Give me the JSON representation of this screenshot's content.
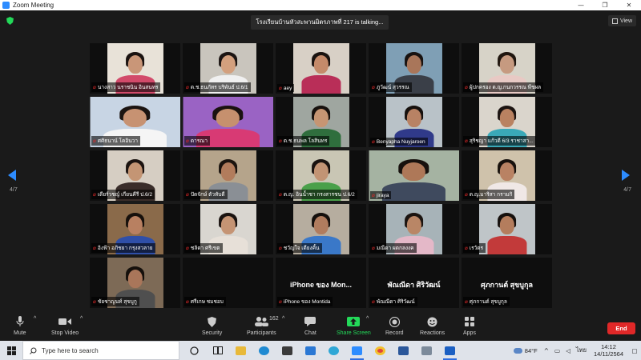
{
  "window": {
    "title": "Zoom Meeting",
    "minimize": "—",
    "restore": "❐",
    "close": "✕"
  },
  "stage": {
    "talking": "โรงเรียนบ้านหัวสะพานมิตรภาพที่ 217 is talking...",
    "view_label": "View",
    "page_left": "4/7",
    "page_right": "4/7"
  },
  "tiles": [
    {
      "name": "นางสาว นราชนิน อินสนทร",
      "muted": true,
      "type": "video",
      "bg": "#e8e2d8",
      "skin": "#c99678",
      "hair": "#1a1210",
      "shirt": "#d24a6a"
    },
    {
      "name": "ด.ช.ธนภัทร บริพันธ์ ป.6/1",
      "muted": true,
      "type": "video",
      "bg": "#c9c5bd",
      "skin": "#d3a07e",
      "hair": "#1c1513",
      "shirt": "#f0f0f0"
    },
    {
      "name": "aey",
      "muted": true,
      "type": "video",
      "bg": "#d8d0c6",
      "skin": "#c48a6a",
      "hair": "#1a1310",
      "shirt": "#b92e58"
    },
    {
      "name": "ภูวัฒน์ สุวรรณ",
      "muted": true,
      "type": "video",
      "bg": "#7f9fb5",
      "skin": "#a9765a",
      "hair": "#181210",
      "shirt": "#3a3f48"
    },
    {
      "name": "ผู้ปกครอง ด.ญ.กนกวรรณ พืชผล",
      "muted": true,
      "type": "video",
      "bg": "#d7d3c8",
      "skin": "#c69a80",
      "hair": "#20160f",
      "shirt": "#e8c9c4"
    },
    {
      "name": "ศศิธนาน์ โคอินวา",
      "muted": true,
      "type": "video",
      "wide": true,
      "bg": "#c8d5e4",
      "skin": "#c79272",
      "hair": "#1b1411",
      "shirt": "#f5f5f5"
    },
    {
      "name": "ดารณา",
      "muted": true,
      "type": "video",
      "wide": true,
      "bg": "#9a63c4",
      "skin": "#c6906e",
      "hair": "#1a1210",
      "shirt": "#d83a74"
    },
    {
      "name": "ด.ช.ธนพล โลสินทร",
      "muted": true,
      "type": "video",
      "bg": "#9fa6a0",
      "skin": "#c69573",
      "hair": "#17110e",
      "shirt": "#2f6e3d"
    },
    {
      "name": "Benyapha Nuyjaroen",
      "muted": true,
      "type": "video",
      "bg": "#b9c2c8",
      "skin": "#b88264",
      "hair": "#16100d",
      "shirt": "#303a8a"
    },
    {
      "name": "สุริชญา แก้วดี 6/3 ราชาสา...",
      "muted": true,
      "type": "video",
      "bg": "#dad5cc",
      "skin": "#b98261",
      "hair": "#1c1411",
      "shirt": "#3aa9b8"
    },
    {
      "name": "เดียร์วชญ์ เกียนคีรี ป.6/2",
      "muted": true,
      "type": "video",
      "bg": "#d6cec3",
      "skin": "#c49574",
      "hair": "#1b1310",
      "shirt": "#3a2d2a"
    },
    {
      "name": "ปัดจักษ์ ตัวทับดี",
      "muted": true,
      "type": "video",
      "bg": "#b5a48b",
      "skin": "#b27c5c",
      "hair": "#1b140f",
      "shirt": "#8a8f95"
    },
    {
      "name": "ด.ญ. อินน้ำชา กรงสารชน ป.6/2",
      "muted": true,
      "type": "video",
      "bg": "#c9c6b4",
      "skin": "#c29474",
      "hair": "#19120f",
      "shirt": "#4aa04a"
    },
    {
      "name": "jiraya",
      "muted": true,
      "type": "video",
      "wide": true,
      "bg": "#a5b3a2",
      "skin": "#ae7858",
      "hair": "#17110d",
      "shirt": "#3f4a5e"
    },
    {
      "name": "ด.ญ.มาริสา กรามกิ",
      "muted": true,
      "type": "video",
      "bg": "#cfc2ab",
      "skin": "#b98263",
      "hair": "#18110d",
      "shirt": "#f0e8e6"
    },
    {
      "name": "อิงฟ้า อภิชยา กรุงสวลาย",
      "muted": true,
      "type": "video",
      "bg": "#8a6a4a",
      "skin": "#b88061",
      "hair": "#16100c",
      "shirt": "#2f4fa8"
    },
    {
      "name": "ชลิดา ศรีเขต",
      "muted": true,
      "type": "video",
      "bg": "#d9d6d0",
      "skin": "#c59474",
      "hair": "#1a1310",
      "shirt": "#e7e0d8"
    },
    {
      "name": "ชวัญใจ เดียงคิ้น",
      "muted": true,
      "type": "video",
      "bg": "#b6ad9f",
      "skin": "#b07c5e",
      "hair": "#15100d",
      "shirt": "#3a78c8"
    },
    {
      "name": "มณีดา ผดกลงงค",
      "muted": true,
      "type": "video",
      "bg": "#a7b3b8",
      "skin": "#b98666",
      "hair": "#1b1410",
      "shirt": "#e4b8c8"
    },
    {
      "name": "เรวัตร",
      "muted": true,
      "type": "video",
      "bg": "#bfc5c8",
      "skin": "#b47d5d",
      "hair": "#16100d",
      "shirt": "#c23a3a"
    },
    {
      "name": "ชัยชาญนท์ สุขบูกู",
      "muted": true,
      "type": "video",
      "bg": "#7d6a56",
      "skin": "#a9765a",
      "hair": "#15100c",
      "shirt": "#4f4f4f"
    },
    {
      "name": "ศรีเกษ ชมชอบ",
      "muted": true,
      "type": "avatar"
    },
    {
      "name": "iPhone ของ Montida",
      "muted": true,
      "type": "avatar",
      "big": "iPhone ของ Mon..."
    },
    {
      "name": "พัณณีดา ศิริวัฒน์",
      "muted": true,
      "type": "avatar",
      "big": "พัณณีดา ศิริวัฒน์"
    },
    {
      "name": "ศุภกานต์ สุขบูกุล",
      "muted": true,
      "type": "avatar",
      "big": "ศุภกานต์ สุขบูกุล"
    }
  ],
  "toolbar": {
    "mute": "Mute",
    "stop_video": "Stop Video",
    "security": "Security",
    "participants": "Participants",
    "participants_count": "162",
    "chat": "Chat",
    "share_screen": "Share Screen",
    "record": "Record",
    "reactions": "Reactions",
    "apps": "Apps",
    "end": "End"
  },
  "taskbar": {
    "search_placeholder": "Type here to search",
    "temperature": "84°F",
    "language": "ไทย",
    "time": "14:12",
    "date": "14/11/2564"
  },
  "colors": {
    "accent": "#2d8cff",
    "end": "#e02828",
    "share": "#23d959"
  }
}
